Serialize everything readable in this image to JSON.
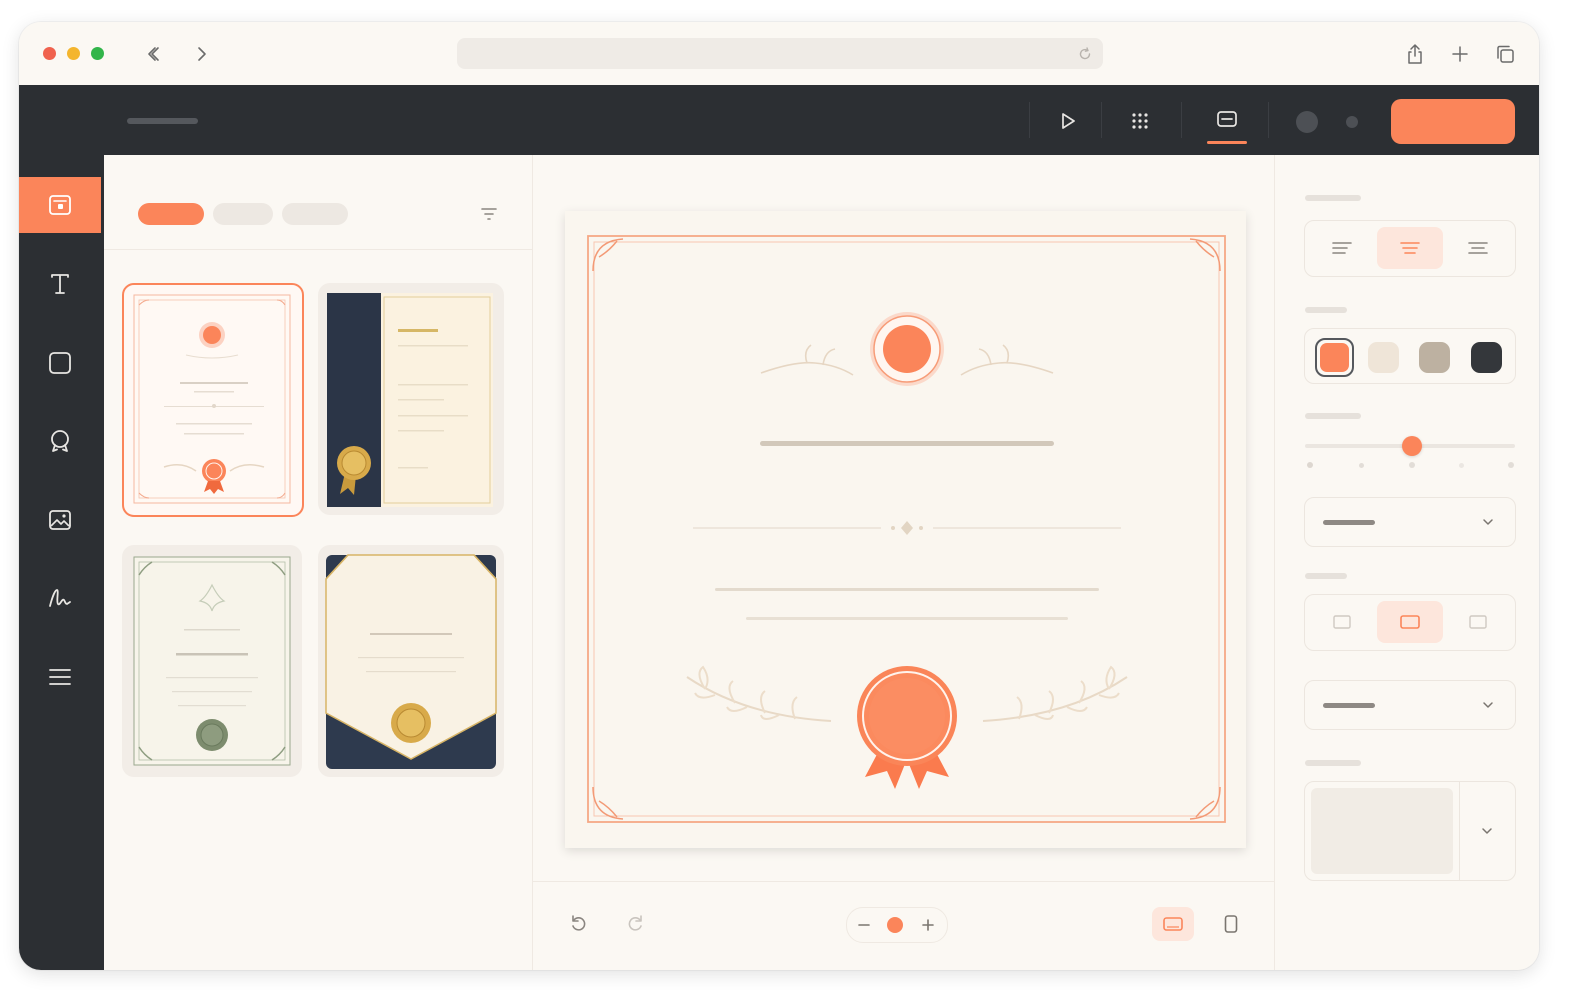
{
  "browser": {
    "traffic_lights": {
      "close": "#f0624e",
      "minimize": "#f4b52d",
      "zoom": "#32b54a"
    },
    "url": "",
    "icons": [
      "chevron-left-icon",
      "chevron-right-icon",
      "reload-icon",
      "share-icon",
      "plus-icon",
      "tabs-icon"
    ]
  },
  "app": {
    "document_title": "",
    "primary_action_label": "",
    "toolbar_icons": [
      "play-icon",
      "grid-icon",
      "layout-icon"
    ],
    "colors": {
      "accent": "#fb855a",
      "dark": "#2c2f33",
      "paper": "#fbf8f3"
    }
  },
  "sidebar": {
    "items": [
      {
        "icon": "templates-icon",
        "active": true
      },
      {
        "icon": "text-icon",
        "active": false
      },
      {
        "icon": "shape-icon",
        "active": false
      },
      {
        "icon": "badge-icon",
        "active": false
      },
      {
        "icon": "image-icon",
        "active": false
      },
      {
        "icon": "signature-icon",
        "active": false
      },
      {
        "icon": "menu-icon",
        "active": false
      }
    ]
  },
  "templates": {
    "filters": [
      "",
      "",
      ""
    ],
    "active_filter_index": 0,
    "cards": [
      {
        "style": "classic-coral",
        "selected": true
      },
      {
        "style": "navy-sidebar-gold",
        "selected": false
      },
      {
        "style": "green-botanical",
        "selected": false
      },
      {
        "style": "navy-gold-corners",
        "selected": false
      }
    ]
  },
  "canvas": {
    "zoom_level": 0.5,
    "orientation": "landscape",
    "icons": [
      "undo-icon",
      "redo-icon",
      "zoom-out-icon",
      "zoom-in-icon",
      "landscape-icon",
      "portrait-icon"
    ]
  },
  "properties": {
    "text_alignment": {
      "options": [
        "left",
        "center",
        "right"
      ],
      "selected": "center"
    },
    "color_swatches": [
      {
        "hex": "#fb855a",
        "selected": true
      },
      {
        "hex": "#efe5d8",
        "selected": false
      },
      {
        "hex": "#bdb1a1",
        "selected": false
      },
      {
        "hex": "#34373b",
        "selected": false
      }
    ],
    "slider": {
      "value": 0.5,
      "steps": 5
    },
    "dropdown_1": {
      "value": ""
    },
    "border_style": {
      "options": [
        "none",
        "single",
        "thin"
      ],
      "selected": "single"
    },
    "dropdown_2": {
      "value": ""
    },
    "background_texture": {
      "value": ""
    }
  }
}
